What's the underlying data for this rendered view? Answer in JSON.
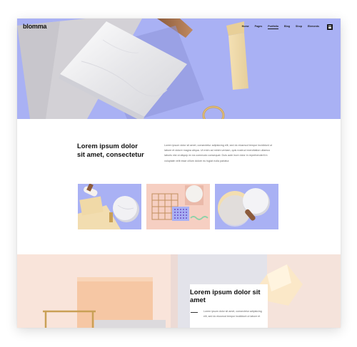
{
  "brand": {
    "logo": "blomma"
  },
  "nav": {
    "items": [
      "Home",
      "Pages",
      "Portfolio",
      "Blog",
      "Shop",
      "Elements"
    ],
    "active_index": 2,
    "menu_icon": "hamburger-icon"
  },
  "colors": {
    "hero_bg": "#a9b1f4",
    "bottom_bg": "#f7ddd2",
    "text_dark": "#111111",
    "text_body": "#666666"
  },
  "intro": {
    "title": "Lorem ipsum dolor sit amet, consectetur",
    "body": "Lorem ipsum dolor sit amet, consectetur adipisicing elit, sed do eiusmod tempor incididunt ut labore et dolore magna aliqua. Ut enim ad minim veniam, quis nostrud exercitation ullamco laboris nisi ut aliquip ex ea commodo consequat. Duis aute irure dolor in reprehenderit in voluptate velit esse cillum dolore eu fugiat nulla pariatur."
  },
  "gallery": {
    "images": [
      "rolls-and-marble",
      "grid-and-pegboard",
      "marble-discs"
    ]
  },
  "feature": {
    "title": "Lorem ipsum dolor sit amet",
    "body": "Lorem ipsum dolor sit amet, consectetur adipisicing elit, sed do eiusmod tempor incididunt ut labore et"
  }
}
